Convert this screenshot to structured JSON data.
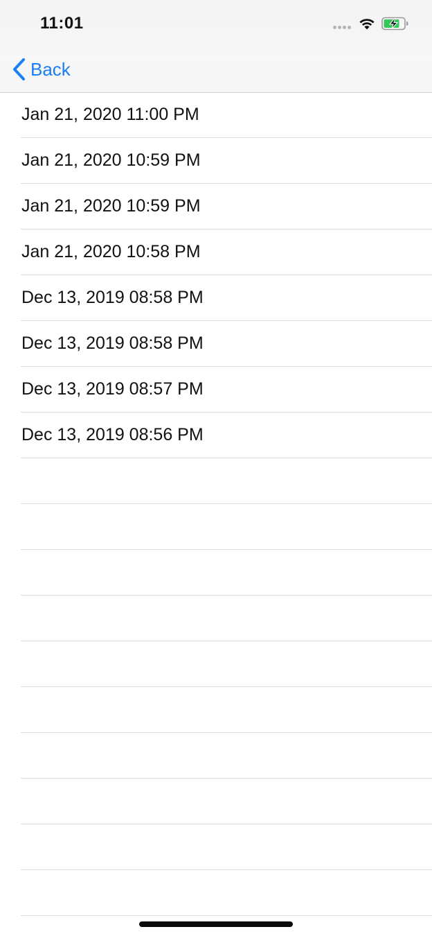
{
  "status_bar": {
    "time": "11:01",
    "battery_charging": true,
    "icons": [
      "signal-dots-icon",
      "wifi-icon",
      "battery-charging-icon"
    ]
  },
  "nav_bar": {
    "back_label": "Back",
    "back_icon": "chevron-left-icon",
    "accent_color": "#1a7ff5"
  },
  "list": {
    "items": [
      {
        "label": "Jan 21, 2020 11:00 PM"
      },
      {
        "label": "Jan 21, 2020 10:59 PM"
      },
      {
        "label": "Jan 21, 2020 10:59 PM"
      },
      {
        "label": "Jan 21, 2020 10:58 PM"
      },
      {
        "label": "Dec 13, 2019 08:58 PM"
      },
      {
        "label": "Dec 13, 2019 08:58 PM"
      },
      {
        "label": "Dec 13, 2019 08:57 PM"
      },
      {
        "label": "Dec 13, 2019 08:56 PM"
      }
    ],
    "empty_rows": 10
  }
}
